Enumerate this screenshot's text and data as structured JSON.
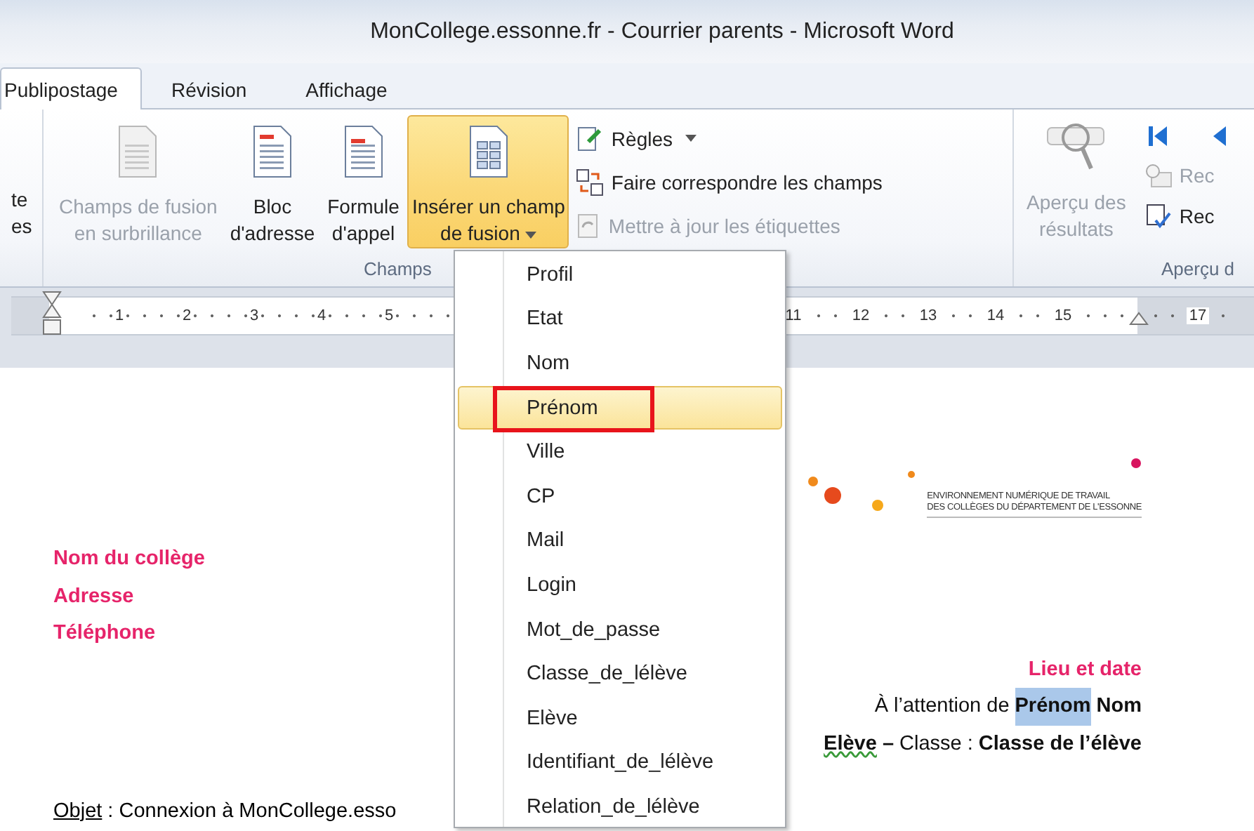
{
  "window": {
    "title": "MonCollege.essonne.fr - Courrier parents  -  Microsoft Word"
  },
  "tabs": [
    {
      "label": "Publipostage",
      "selected": true
    },
    {
      "label": "Révision",
      "selected": false
    },
    {
      "label": "Affichage",
      "selected": false
    }
  ],
  "ribbon": {
    "left_fragment": [
      "te",
      "es"
    ],
    "fields_group": {
      "label": "Champs",
      "large_buttons": [
        {
          "kind": "highlight",
          "label_lines": [
            "Champs de fusion",
            "en surbrillance"
          ],
          "disabled": true,
          "selected": false,
          "dropdown": false
        },
        {
          "kind": "address",
          "label_lines": [
            "Bloc",
            "d'adresse"
          ],
          "disabled": false,
          "selected": false,
          "dropdown": false
        },
        {
          "kind": "greeting",
          "label_lines": [
            "Formule",
            "d'appel"
          ],
          "disabled": false,
          "selected": false,
          "dropdown": false
        },
        {
          "kind": "insert",
          "label_lines": [
            "Insérer un champ",
            "de fusion"
          ],
          "disabled": false,
          "selected": true,
          "dropdown": true
        }
      ],
      "small_buttons": [
        {
          "kind": "rules",
          "label": "Règles",
          "disabled": false,
          "dropdown": true
        },
        {
          "kind": "match",
          "label": "Faire correspondre les champs",
          "disabled": false,
          "dropdown": false
        },
        {
          "kind": "update",
          "label": "Mettre à jour les étiquettes",
          "disabled": true,
          "dropdown": false
        }
      ]
    },
    "preview_group": {
      "label": "Aperçu d",
      "button": {
        "label_lines": [
          "Aperçu des",
          "résultats"
        ],
        "disabled": true
      },
      "small_buttons": [
        {
          "kind": "find",
          "label": "Rec",
          "disabled": true
        },
        {
          "kind": "check",
          "label": "Rec",
          "disabled": false
        }
      ]
    }
  },
  "ruler": {
    "left_numbers": [
      "1",
      "2",
      "3",
      "4",
      "5"
    ],
    "right_numbers": [
      "11",
      "12",
      "13",
      "14",
      "15"
    ],
    "end_number": "17"
  },
  "menu": {
    "items": [
      {
        "label": "Profil",
        "selected": false,
        "outlined": false
      },
      {
        "label": "Etat",
        "selected": false,
        "outlined": false
      },
      {
        "label": "Nom",
        "selected": false,
        "outlined": false
      },
      {
        "label": "Prénom",
        "selected": true,
        "outlined": true
      },
      {
        "label": "Ville",
        "selected": false,
        "outlined": false
      },
      {
        "label": "CP",
        "selected": false,
        "outlined": false
      },
      {
        "label": "Mail",
        "selected": false,
        "outlined": false
      },
      {
        "label": "Login",
        "selected": false,
        "outlined": false
      },
      {
        "label": "Mot_de_passe",
        "selected": false,
        "outlined": false
      },
      {
        "label": "Classe_de_lélève",
        "selected": false,
        "outlined": false
      },
      {
        "label": "Elève",
        "selected": false,
        "outlined": false
      },
      {
        "label": "Identifiant_de_lélève",
        "selected": false,
        "outlined": false
      },
      {
        "label": "Relation_de_lélève",
        "selected": false,
        "outlined": false
      }
    ]
  },
  "document": {
    "logo_lines": [
      "ENVIRONNEMENT NUMÉRIQUE DE TRAVAIL",
      "DES COLLÈGES DU DÉPARTEMENT DE L'ESSONNE"
    ],
    "address_lines": [
      "Nom du collège",
      "Adresse",
      "Téléphone"
    ],
    "place_date": "Lieu et date",
    "attention": {
      "prefix": "À l’attention de",
      "first_name": "Prénom",
      "first_name_highlighted": true,
      "last_name": "Nom"
    },
    "class_line": {
      "student": "Elève",
      "dash": "–",
      "label": "Classe :",
      "value": "Classe de l’élève"
    },
    "subject": {
      "label": "Objet",
      "text": ": Connexion à MonCollege.esso"
    }
  }
}
